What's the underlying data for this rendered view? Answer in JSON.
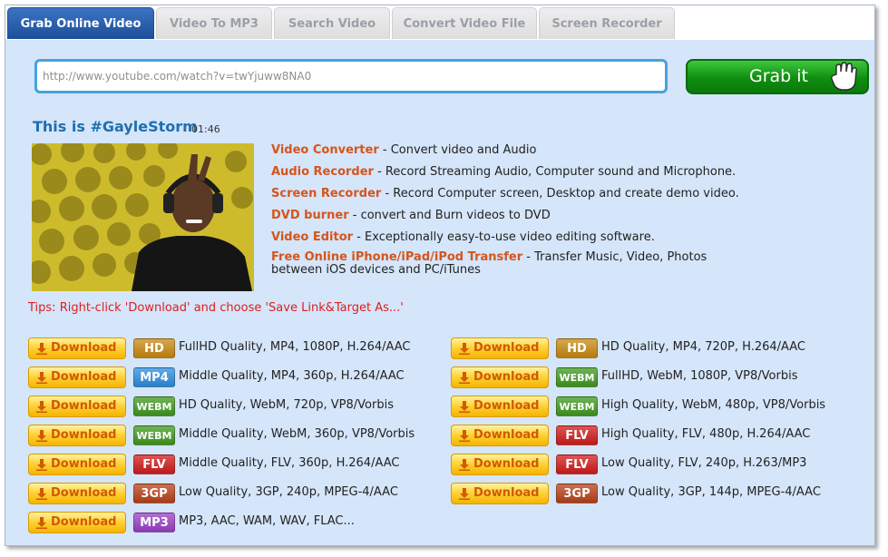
{
  "tabs": [
    {
      "label": "Grab Online Video",
      "active": true
    },
    {
      "label": "Video To MP3",
      "active": false
    },
    {
      "label": "Search Video",
      "active": false
    },
    {
      "label": "Convert Video File",
      "active": false
    },
    {
      "label": "Screen Recorder",
      "active": false
    }
  ],
  "url_input": {
    "value": "http://www.youtube.com/watch?v=twYjuww8NA0"
  },
  "grab_button": {
    "label": "Grab it"
  },
  "video": {
    "title": "This is #GayleStorm",
    "duration": "01:46"
  },
  "products": [
    {
      "name": "Video Converter",
      "desc": " - Convert video and Audio"
    },
    {
      "name": "Audio Recorder",
      "desc": " - Record Streaming Audio, Computer sound and Microphone."
    },
    {
      "name": "Screen Recorder",
      "desc": " - Record Computer screen, Desktop and create demo video."
    },
    {
      "name": "DVD burner",
      "desc": " - convert and Burn videos to DVD"
    },
    {
      "name": "Video Editor",
      "desc": " - Exceptionally easy-to-use video editing software."
    },
    {
      "name": "Free Online iPhone/iPad/iPod Transfer",
      "desc": " - Transfer Music, Video, Photos between iOS devices and PC/iTunes"
    }
  ],
  "tips": "Tips: Right-click 'Download' and choose 'Save Link&Target As...'",
  "download_label": "Download",
  "downloads_left": [
    {
      "badge": "HD",
      "color": "#c98a10",
      "desc": "FullHD Quality, MP4, 1080P, H.264/AAC"
    },
    {
      "badge": "MP4",
      "color": "#2c8fe0",
      "desc": "Middle Quality, MP4, 360p, H.264/AAC"
    },
    {
      "badge": "WEBM",
      "color": "#3f9a1e",
      "desc": "HD Quality, WebM, 720p, VP8/Vorbis"
    },
    {
      "badge": "WEBM",
      "color": "#3f9a1e",
      "desc": "Middle Quality, WebM, 360p, VP8/Vorbis"
    },
    {
      "badge": "FLV",
      "color": "#d21b1b",
      "desc": "Middle Quality, FLV, 360p, H.264/AAC"
    },
    {
      "badge": "3GP",
      "color": "#b8421a",
      "desc": "Low Quality, 3GP, 240p, MPEG-4/AAC"
    },
    {
      "badge": "MP3",
      "color": "#9b3fc6",
      "desc": "MP3, AAC, WAM, WAV, FLAC..."
    }
  ],
  "downloads_right": [
    {
      "badge": "HD",
      "color": "#c98a10",
      "desc": "HD Quality, MP4, 720P, H.264/AAC"
    },
    {
      "badge": "WEBM",
      "color": "#3f9a1e",
      "desc": "FullHD, WebM, 1080P, VP8/Vorbis"
    },
    {
      "badge": "WEBM",
      "color": "#3f9a1e",
      "desc": "High Quality, WebM, 480p, VP8/Vorbis"
    },
    {
      "badge": "FLV",
      "color": "#d21b1b",
      "desc": "High Quality, FLV, 480p, H.264/AAC"
    },
    {
      "badge": "FLV",
      "color": "#d21b1b",
      "desc": "Low Quality, FLV, 240p, H.263/MP3"
    },
    {
      "badge": "3GP",
      "color": "#b8421a",
      "desc": "Low Quality, 3GP, 144p, MPEG-4/AAC"
    }
  ]
}
